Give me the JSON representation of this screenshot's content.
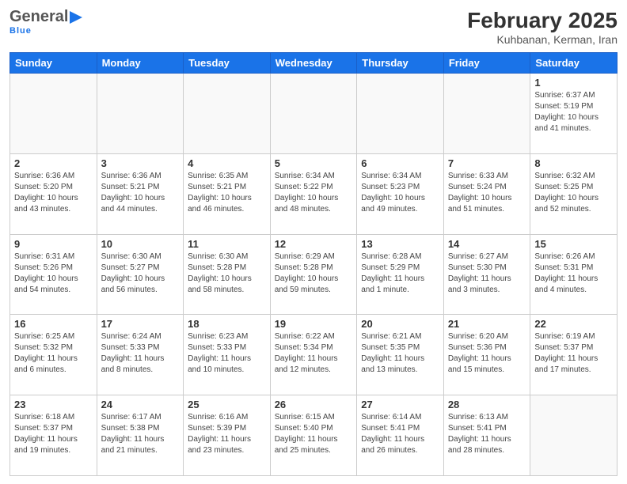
{
  "header": {
    "logo_general": "General",
    "logo_blue": "Blue",
    "month_title": "February 2025",
    "location": "Kuhbanan, Kerman, Iran"
  },
  "days_of_week": [
    "Sunday",
    "Monday",
    "Tuesday",
    "Wednesday",
    "Thursday",
    "Friday",
    "Saturday"
  ],
  "weeks": [
    [
      {
        "day": "",
        "info": ""
      },
      {
        "day": "",
        "info": ""
      },
      {
        "day": "",
        "info": ""
      },
      {
        "day": "",
        "info": ""
      },
      {
        "day": "",
        "info": ""
      },
      {
        "day": "",
        "info": ""
      },
      {
        "day": "1",
        "info": "Sunrise: 6:37 AM\nSunset: 5:19 PM\nDaylight: 10 hours\nand 41 minutes."
      }
    ],
    [
      {
        "day": "2",
        "info": "Sunrise: 6:36 AM\nSunset: 5:20 PM\nDaylight: 10 hours\nand 43 minutes."
      },
      {
        "day": "3",
        "info": "Sunrise: 6:36 AM\nSunset: 5:21 PM\nDaylight: 10 hours\nand 44 minutes."
      },
      {
        "day": "4",
        "info": "Sunrise: 6:35 AM\nSunset: 5:21 PM\nDaylight: 10 hours\nand 46 minutes."
      },
      {
        "day": "5",
        "info": "Sunrise: 6:34 AM\nSunset: 5:22 PM\nDaylight: 10 hours\nand 48 minutes."
      },
      {
        "day": "6",
        "info": "Sunrise: 6:34 AM\nSunset: 5:23 PM\nDaylight: 10 hours\nand 49 minutes."
      },
      {
        "day": "7",
        "info": "Sunrise: 6:33 AM\nSunset: 5:24 PM\nDaylight: 10 hours\nand 51 minutes."
      },
      {
        "day": "8",
        "info": "Sunrise: 6:32 AM\nSunset: 5:25 PM\nDaylight: 10 hours\nand 52 minutes."
      }
    ],
    [
      {
        "day": "9",
        "info": "Sunrise: 6:31 AM\nSunset: 5:26 PM\nDaylight: 10 hours\nand 54 minutes."
      },
      {
        "day": "10",
        "info": "Sunrise: 6:30 AM\nSunset: 5:27 PM\nDaylight: 10 hours\nand 56 minutes."
      },
      {
        "day": "11",
        "info": "Sunrise: 6:30 AM\nSunset: 5:28 PM\nDaylight: 10 hours\nand 58 minutes."
      },
      {
        "day": "12",
        "info": "Sunrise: 6:29 AM\nSunset: 5:28 PM\nDaylight: 10 hours\nand 59 minutes."
      },
      {
        "day": "13",
        "info": "Sunrise: 6:28 AM\nSunset: 5:29 PM\nDaylight: 11 hours\nand 1 minute."
      },
      {
        "day": "14",
        "info": "Sunrise: 6:27 AM\nSunset: 5:30 PM\nDaylight: 11 hours\nand 3 minutes."
      },
      {
        "day": "15",
        "info": "Sunrise: 6:26 AM\nSunset: 5:31 PM\nDaylight: 11 hours\nand 4 minutes."
      }
    ],
    [
      {
        "day": "16",
        "info": "Sunrise: 6:25 AM\nSunset: 5:32 PM\nDaylight: 11 hours\nand 6 minutes."
      },
      {
        "day": "17",
        "info": "Sunrise: 6:24 AM\nSunset: 5:33 PM\nDaylight: 11 hours\nand 8 minutes."
      },
      {
        "day": "18",
        "info": "Sunrise: 6:23 AM\nSunset: 5:33 PM\nDaylight: 11 hours\nand 10 minutes."
      },
      {
        "day": "19",
        "info": "Sunrise: 6:22 AM\nSunset: 5:34 PM\nDaylight: 11 hours\nand 12 minutes."
      },
      {
        "day": "20",
        "info": "Sunrise: 6:21 AM\nSunset: 5:35 PM\nDaylight: 11 hours\nand 13 minutes."
      },
      {
        "day": "21",
        "info": "Sunrise: 6:20 AM\nSunset: 5:36 PM\nDaylight: 11 hours\nand 15 minutes."
      },
      {
        "day": "22",
        "info": "Sunrise: 6:19 AM\nSunset: 5:37 PM\nDaylight: 11 hours\nand 17 minutes."
      }
    ],
    [
      {
        "day": "23",
        "info": "Sunrise: 6:18 AM\nSunset: 5:37 PM\nDaylight: 11 hours\nand 19 minutes."
      },
      {
        "day": "24",
        "info": "Sunrise: 6:17 AM\nSunset: 5:38 PM\nDaylight: 11 hours\nand 21 minutes."
      },
      {
        "day": "25",
        "info": "Sunrise: 6:16 AM\nSunset: 5:39 PM\nDaylight: 11 hours\nand 23 minutes."
      },
      {
        "day": "26",
        "info": "Sunrise: 6:15 AM\nSunset: 5:40 PM\nDaylight: 11 hours\nand 25 minutes."
      },
      {
        "day": "27",
        "info": "Sunrise: 6:14 AM\nSunset: 5:41 PM\nDaylight: 11 hours\nand 26 minutes."
      },
      {
        "day": "28",
        "info": "Sunrise: 6:13 AM\nSunset: 5:41 PM\nDaylight: 11 hours\nand 28 minutes."
      },
      {
        "day": "",
        "info": ""
      }
    ]
  ]
}
